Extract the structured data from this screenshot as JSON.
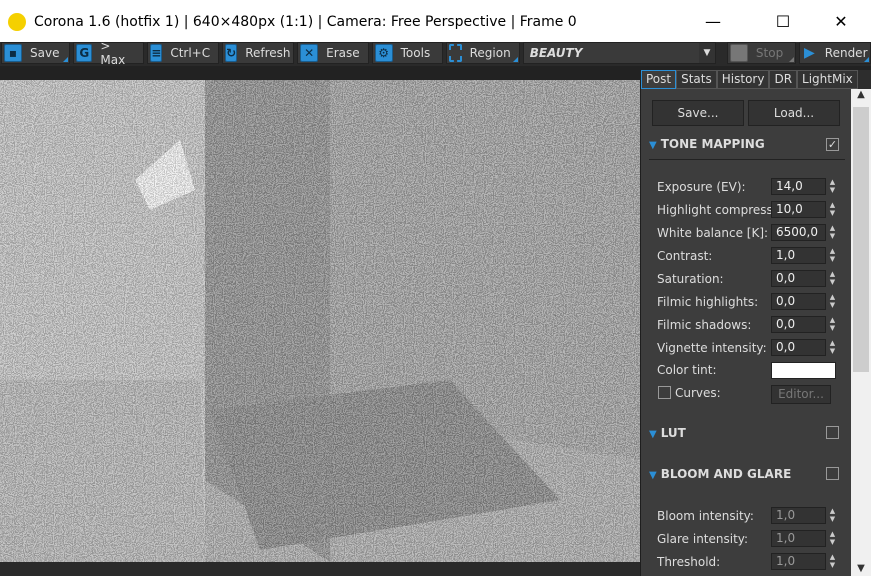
{
  "window": {
    "title": "Corona 1.6 (hotfix 1) | 640×480px (1:1) | Camera: Free Perspective | Frame 0",
    "minimize": "—",
    "maximize": "☐",
    "close": "✕"
  },
  "toolbar": {
    "save": "Save",
    "max": "> Max",
    "copy": "Ctrl+C",
    "refresh": "Refresh",
    "erase": "Erase",
    "tools": "Tools",
    "region": "Region",
    "channel": "BEAUTY",
    "stop": "Stop",
    "render": "Render"
  },
  "tabs": [
    "Post",
    "Stats",
    "History",
    "DR",
    "LightMix"
  ],
  "post": {
    "save": "Save...",
    "load": "Load...",
    "tone_mapping": {
      "title": "TONE MAPPING",
      "enabled": true,
      "fields": [
        {
          "label": "Exposure (EV):",
          "value": "14,0"
        },
        {
          "label": "Highlight compress:",
          "value": "10,0"
        },
        {
          "label": "White balance [K]:",
          "value": "6500,0"
        },
        {
          "label": "Contrast:",
          "value": "1,0"
        },
        {
          "label": "Saturation:",
          "value": "0,0"
        },
        {
          "label": "Filmic highlights:",
          "value": "0,0"
        },
        {
          "label": "Filmic shadows:",
          "value": "0,0"
        },
        {
          "label": "Vignette intensity:",
          "value": "0,0"
        }
      ],
      "color_tint_label": "Color tint:",
      "color_tint": "#ffffff",
      "curves_label": "Curves:",
      "curves_enabled": false,
      "editor": "Editor..."
    },
    "lut": {
      "title": "LUT",
      "enabled": false
    },
    "bloom": {
      "title": "BLOOM AND GLARE",
      "enabled": false,
      "fields": [
        {
          "label": "Bloom intensity:",
          "value": "1,0"
        },
        {
          "label": "Glare intensity:",
          "value": "1,0"
        },
        {
          "label": "Threshold:",
          "value": "1,0"
        }
      ]
    }
  }
}
